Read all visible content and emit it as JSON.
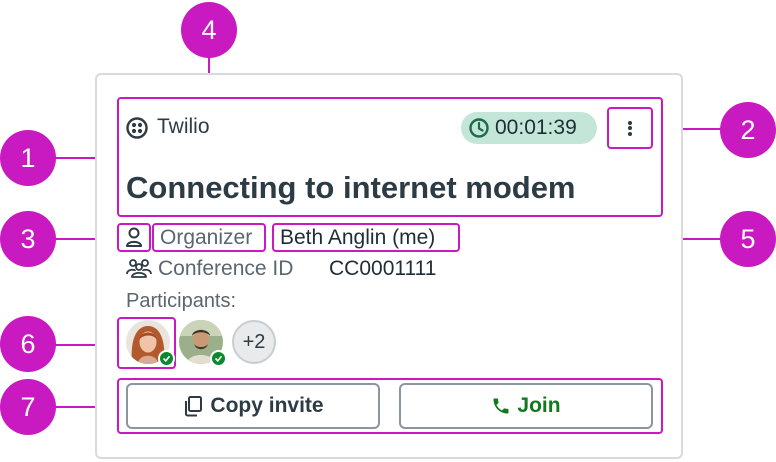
{
  "card": {
    "provider_label": "Twilio",
    "timer": "00:01:39",
    "title": "Connecting to internet modem",
    "organizer_label": "Organizer",
    "organizer_name": "Beth Anglin (me)",
    "conference_label": "Conference ID",
    "conference_id": "CC0001111",
    "participants_label": "Participants:",
    "extra_participants": "+2",
    "copy_invite_label": "Copy invite",
    "join_label": "Join"
  },
  "callouts": [
    "1",
    "2",
    "3",
    "4",
    "5",
    "6",
    "7"
  ],
  "colors": {
    "annotation": "#c81ac0",
    "timer_bg": "#c3e6d9",
    "join_green": "#127a1c",
    "online_badge": "#0b8a2d"
  },
  "icons": [
    "twilio-icon",
    "clock-icon",
    "more-vertical-icon",
    "person-icon",
    "group-icon",
    "copy-icon",
    "phone-icon",
    "check-icon"
  ]
}
